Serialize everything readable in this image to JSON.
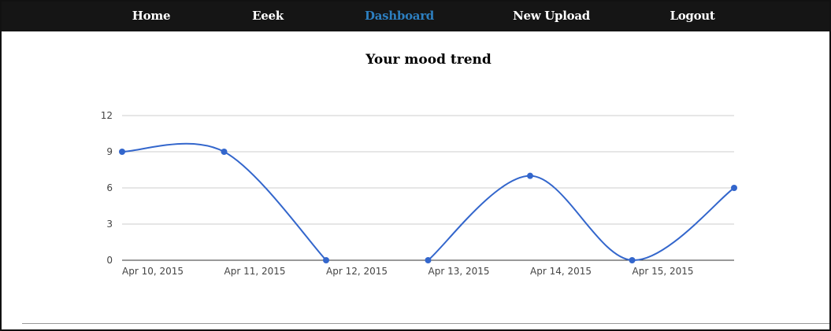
{
  "nav": {
    "items": [
      {
        "label": "Home",
        "active": false
      },
      {
        "label": "Eeek",
        "active": false
      },
      {
        "label": "Dashboard",
        "active": true
      },
      {
        "label": "New Upload",
        "active": false
      },
      {
        "label": "Logout",
        "active": false
      }
    ]
  },
  "colors": {
    "navbar_bg": "#151515",
    "nav_active": "#2d7fc0",
    "series_line": "#3366cc",
    "grid": "#cccccc"
  },
  "chart_data": {
    "type": "line",
    "title": "Your mood trend",
    "xlabel": "",
    "ylabel": "",
    "ylim": [
      0,
      12
    ],
    "yticks": [
      "0",
      "3",
      "6",
      "9",
      "12"
    ],
    "xticks": [
      "Apr 10, 2015",
      "Apr 11, 2015",
      "Apr 12, 2015",
      "Apr 13, 2015",
      "Apr 14, 2015",
      "Apr 15, 2015"
    ],
    "grid": true,
    "legend": "none",
    "series": [
      {
        "x": [
          "2015-04-10",
          "2015-04-11",
          "2015-04-12",
          "2015-04-13",
          "2015-04-14",
          "2015-04-15",
          "2015-04-16"
        ],
        "values": [
          9,
          9,
          0,
          null,
          null,
          null,
          null
        ]
      },
      {
        "x": [
          "2015-04-10",
          "2015-04-11",
          "2015-04-12",
          "2015-04-13",
          "2015-04-14",
          "2015-04-15",
          "2015-04-16"
        ],
        "values": [
          null,
          null,
          null,
          0,
          7,
          0,
          6
        ]
      }
    ]
  }
}
